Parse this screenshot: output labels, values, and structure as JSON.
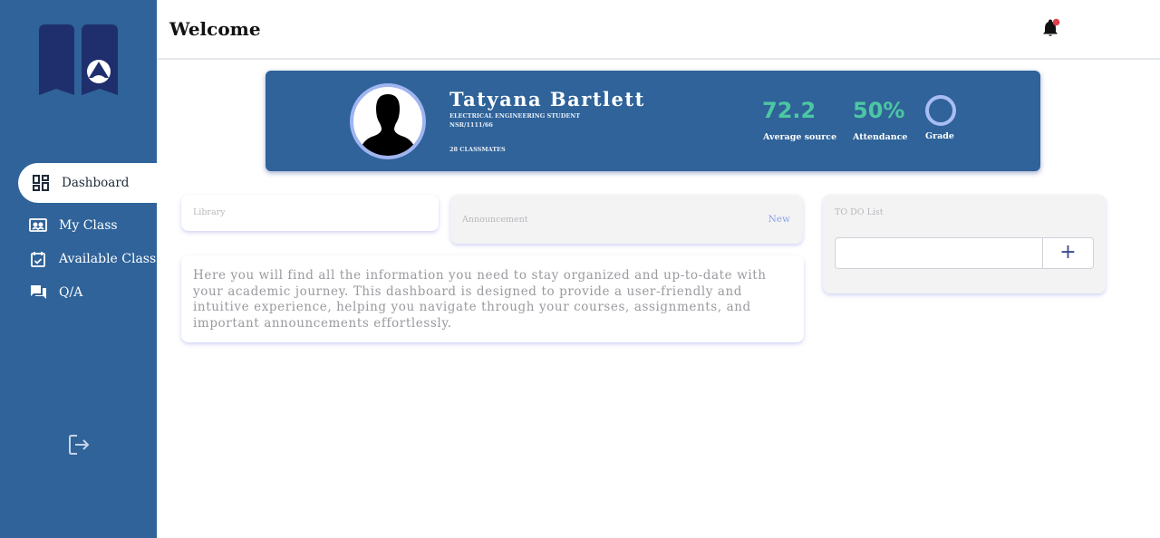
{
  "header": {
    "title": "Welcome"
  },
  "sidebar": {
    "items": [
      {
        "label": "Dashboard",
        "icon": "dashboard-icon",
        "active": true
      },
      {
        "label": "My Class",
        "icon": "class-icon"
      },
      {
        "label": "Available Class",
        "icon": "calendar-check-icon"
      },
      {
        "label": "Q/A",
        "icon": "chat-icon"
      }
    ]
  },
  "profile": {
    "name": "Tatyana Bartlett",
    "program": "ELECTRICAL ENGINEERING STUDENT",
    "id": "NSR/1111/66",
    "classmates": "28 CLASSMATES",
    "stats": [
      {
        "value": "72.2",
        "label": "Average source"
      },
      {
        "value": "50%",
        "label": "Attendance"
      },
      {
        "value": "",
        "label": "Grade"
      }
    ]
  },
  "library": {
    "label": "Library"
  },
  "announcement": {
    "label": "Announcement",
    "badge": "New"
  },
  "info": {
    "text": "Here you will find all the information you need to stay organized and up-to-date with your academic journey. This dashboard is designed to provide a user-friendly and intuitive experience, helping you navigate through your courses, assignments, and important announcements effortlessly."
  },
  "todo": {
    "label": "TO DO List",
    "input_value": "",
    "add_label": "+"
  },
  "colors": {
    "sidebar": "#2f6399",
    "accent_stat": "#4cc7a2",
    "notification_dot": "#e0404a",
    "grade_ring": "#a9bdf5"
  }
}
